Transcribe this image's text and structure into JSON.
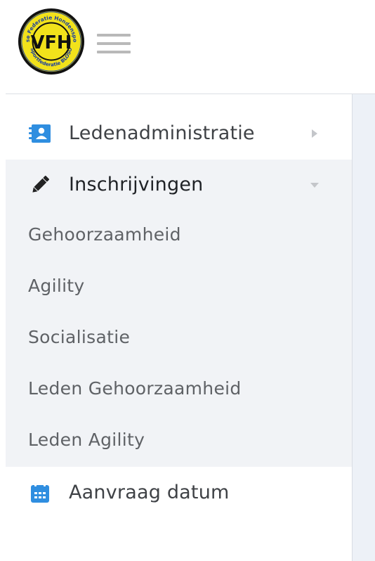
{
  "header": {
    "logo": {
      "top_text": "Vlaamse Federatie Hondensport vzw",
      "monogram": "VFH",
      "bottom_text": "Sportfederatie BLOSO",
      "colors": {
        "fill": "#f2e21b",
        "ring": "#111111",
        "accent": "#1b3fa0"
      }
    },
    "menu_icon": "hamburger-icon"
  },
  "sidebar": {
    "items": [
      {
        "label": "Ledenadministratie",
        "icon": "contact-book-icon",
        "icon_color": "#2f8ee0",
        "arrow": "caret-right-icon",
        "expanded": false
      },
      {
        "label": "Inschrijvingen",
        "icon": "pencil-icon",
        "icon_color": "#222222",
        "arrow": "caret-down-icon",
        "expanded": true,
        "children": [
          {
            "label": "Gehoorzaamheid"
          },
          {
            "label": "Agility"
          },
          {
            "label": "Socialisatie"
          },
          {
            "label": "Leden Gehoorzaamheid"
          },
          {
            "label": "Leden Agility"
          }
        ]
      },
      {
        "label": "Aanvraag datum",
        "icon": "calendar-icon",
        "icon_color": "#2f8ee0"
      }
    ]
  },
  "colors": {
    "submenu_bg": "#f1f3f6",
    "content_bg": "#edf1f7",
    "text": "#3f4246",
    "subtext": "#5f6266",
    "arrow": "#c4c6ca"
  }
}
